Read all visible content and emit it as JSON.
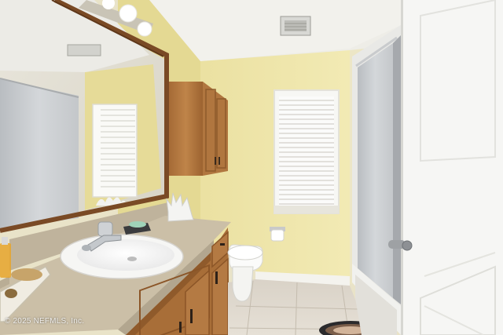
{
  "photo": {
    "subject": "bathroom",
    "watermark": "© 2025 NEFMLS, Inc."
  },
  "palette": {
    "wall": "#efe6a4",
    "ceiling": "#f1f0ea",
    "cabinet_wood": "#b47a43",
    "countertop": "#cbbfa7",
    "floor_tile": "#ddd6cb",
    "door": "#f6f6f4",
    "shower_glass": "#c9cccf",
    "mirror_frame": "#7a4a25"
  }
}
